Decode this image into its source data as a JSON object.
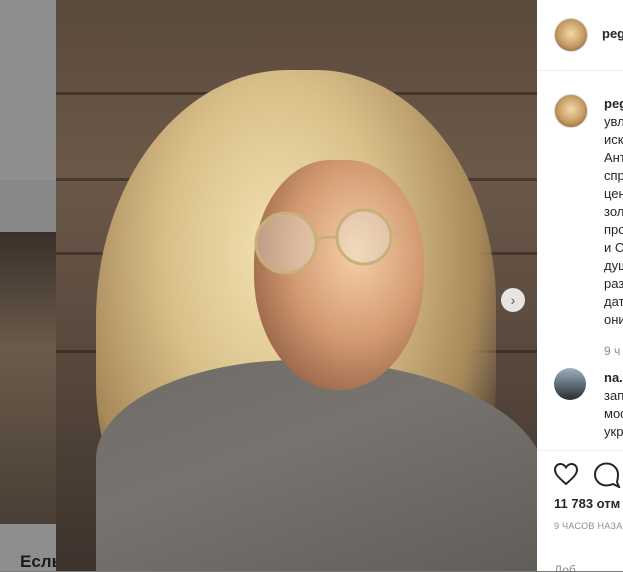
{
  "background_page": {
    "caption_fragment": "Есль"
  },
  "post": {
    "author": "peg",
    "caption_author": "peg",
    "caption_lines": [
      "увл",
      "иск",
      "Ант",
      "спр",
      "цен",
      "зол",
      "про",
      "и С",
      "душ",
      "раз",
      "дат",
      "они"
    ],
    "caption_time": "9 ч",
    "comment": {
      "author": "na.",
      "lines": [
        "зап",
        "мос",
        "укр"
      ]
    },
    "likes": "11 783 отм",
    "time_ago": "9 ЧАСОВ НАЗАД",
    "add_comment_placeholder": "Доб"
  },
  "icons": {
    "like": "heart-icon",
    "comment": "speech-bubble-icon",
    "next": "chevron-right-icon"
  },
  "colors": {
    "text": "#262626",
    "muted": "#8e8e8e",
    "border": "#efefef"
  }
}
